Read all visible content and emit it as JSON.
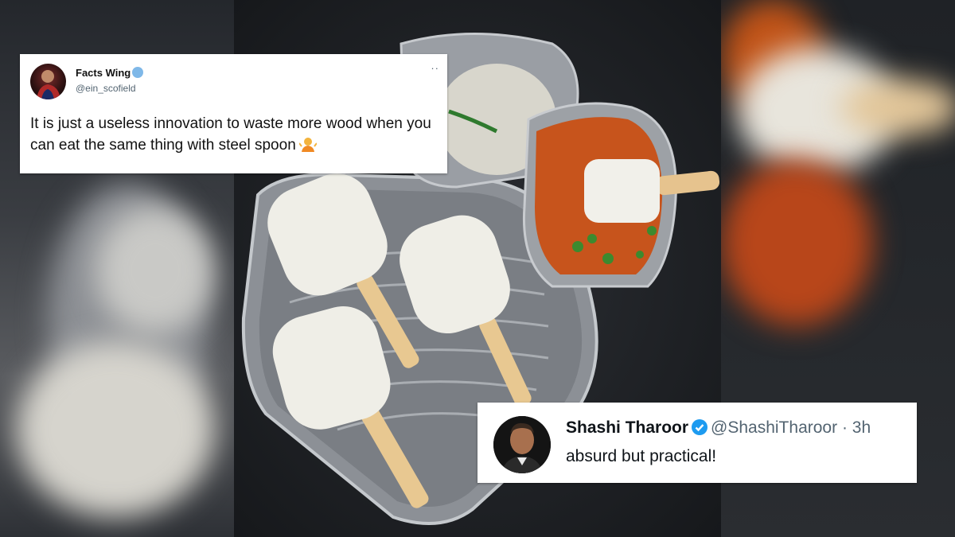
{
  "tweets": {
    "top": {
      "name": "Facts Wing",
      "name_emoji": "cold-face-emoji",
      "handle": "@ein_scofield",
      "menu_icon": "more-dots-icon",
      "text": "It is just a useless innovation to waste more wood when you can eat the same thing with steel spoon",
      "text_emoji": "person-shrugging-emoji"
    },
    "bottom": {
      "name": "Shashi Tharoor",
      "verified_icon": "verified-badge-icon",
      "handle": "@ShashiTharoor",
      "separator": "·",
      "time": "3h",
      "text": "absurd but practical!"
    }
  },
  "photo": {
    "subject": "idli-popsicles-on-steel-plate",
    "items": [
      "idli-stick-1",
      "idli-stick-2",
      "idli-stick-3",
      "coconut-chutney-bowl",
      "sambar-bowl"
    ]
  },
  "colors": {
    "verified_blue": "#1d9bf0",
    "handle_gray": "#536471",
    "text_dark": "#0f1419"
  }
}
